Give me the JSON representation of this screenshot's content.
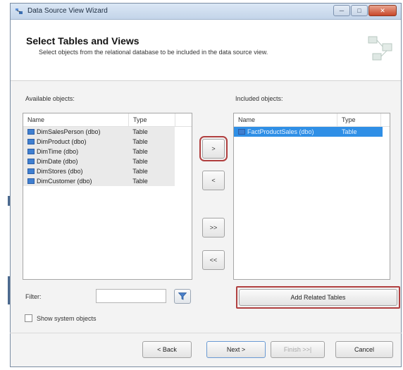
{
  "window": {
    "title": "Data Source View Wizard"
  },
  "header": {
    "title": "Select Tables and Views",
    "subtitle": "Select objects from the relational database to be included in the data source view."
  },
  "available": {
    "label": "Available objects:",
    "columns": {
      "name": "Name",
      "type": "Type"
    },
    "rows": [
      {
        "name": "DimSalesPerson (dbo)",
        "type": "Table"
      },
      {
        "name": "DimProduct (dbo)",
        "type": "Table"
      },
      {
        "name": "DimTime (dbo)",
        "type": "Table"
      },
      {
        "name": "DimDate (dbo)",
        "type": "Table"
      },
      {
        "name": "DimStores (dbo)",
        "type": "Table"
      },
      {
        "name": "DimCustomer (dbo)",
        "type": "Table"
      }
    ]
  },
  "included": {
    "label": "Included objects:",
    "columns": {
      "name": "Name",
      "type": "Type"
    },
    "rows": [
      {
        "name": "FactProductSales (dbo)",
        "type": "Table",
        "selected": true
      }
    ]
  },
  "movers": {
    "add": ">",
    "remove": "<",
    "add_all": ">>",
    "remove_all": "<<"
  },
  "filter": {
    "label": "Filter:",
    "value": ""
  },
  "show_system": {
    "label": "Show system objects",
    "checked": false
  },
  "add_related": "Add Related Tables",
  "footer": {
    "back": "< Back",
    "next": "Next >",
    "finish": "Finish >>|",
    "cancel": "Cancel"
  },
  "colors": {
    "selection": "#2f8fe6",
    "highlight": "#b03f3f",
    "table_icon": "#3f7fd0"
  }
}
